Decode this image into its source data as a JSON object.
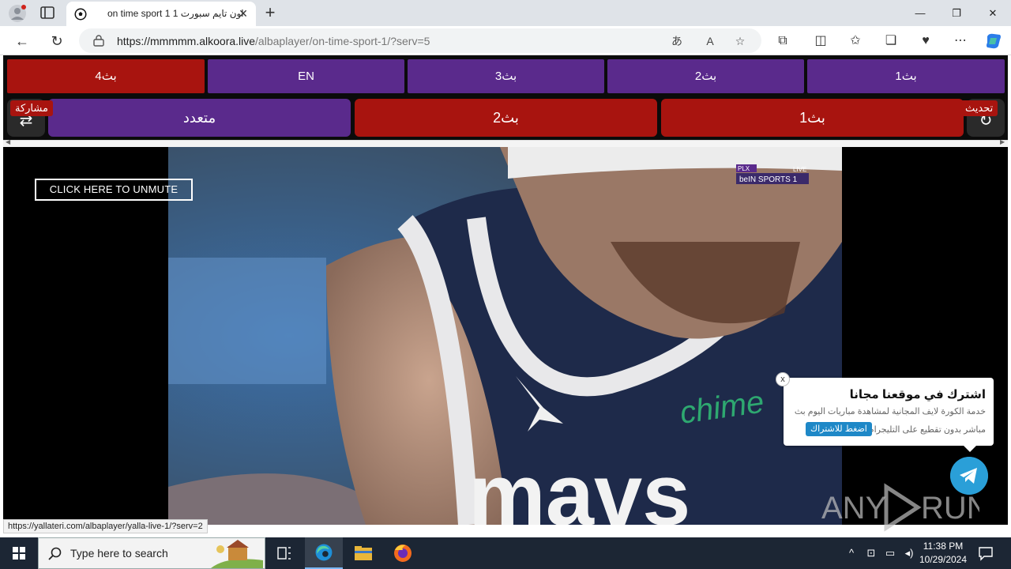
{
  "browser": {
    "tab_title": "on time sport 1 اون تايم سبورت 1",
    "tab_close": "✕",
    "new_tab": "+",
    "url_host": "https://mmmmm.alkoora.live",
    "url_path": "/albaplayer/on-time-sport-1/?serv=5",
    "window_controls": {
      "minimize": "—",
      "maximize": "❐",
      "close": "✕"
    }
  },
  "servers_row1": [
    "بث4",
    "EN",
    "بث3",
    "بث2",
    "بث1"
  ],
  "servers_row2": [
    "متعدد",
    "بث2",
    "بث1"
  ],
  "side": {
    "share_label": "مشاركة",
    "refresh_label": "تحديث"
  },
  "player": {
    "unmute_label": "CLICK HERE TO UNMUTE",
    "channel_logo": "beIN SPORTS 1",
    "live_label": "LIVE"
  },
  "popup": {
    "title": "اشترك في موقعنا مجانا",
    "line1": "خدمة الكورة لايف المجانية لمشاهدة مباريات اليوم بث",
    "line2": "مباشر بدون تقطيع على التليجرام",
    "button": "اضغط للاشتراك",
    "close": "x"
  },
  "status_url": "https://yallateri.com/albaplayer/yalla-live-1/?serv=2",
  "watermark": "ANY RUN",
  "taskbar": {
    "search_placeholder": "Type here to search",
    "time": "11:38 PM",
    "date": "10/29/2024"
  },
  "colors": {
    "red": "#a8140f",
    "purple": "#5a2a8c",
    "telegram": "#2a9fd8",
    "taskbar": "#1c2634"
  }
}
